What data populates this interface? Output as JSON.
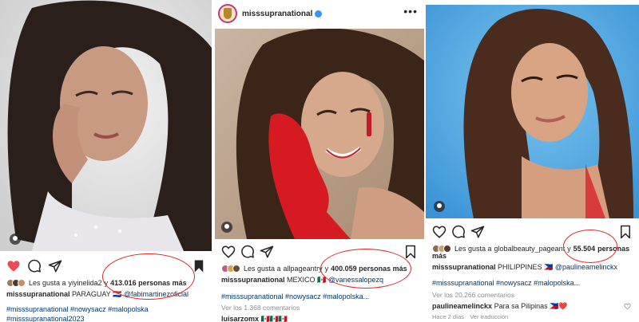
{
  "posts": [
    {
      "likes_prefix": "Les gusta a",
      "liker": "yiyinelida2",
      "likes_joiner": "y",
      "likes_count": "413.016 personas más",
      "caption_user": "misssupranational",
      "caption_text": "PARAGUAY",
      "caption_flag": "🇵🇾",
      "caption_mention": "@fabimartinezoficial",
      "hashtags": "#misssupranational #nowysacz #malopolska",
      "hashtags2": "#misssupranational2023",
      "liked": true,
      "accent": "#ed4956"
    },
    {
      "account": "misssupranational",
      "more_label": "•••",
      "likes_prefix": "Les gusta a",
      "liker": "allpageantry",
      "likes_joiner": "y",
      "likes_count": "400.059 personas más",
      "caption_user": "misssupranational",
      "caption_text": "MEXICO",
      "caption_flag": "🇲🇽",
      "caption_mention": "@vanessalopezq",
      "hashtags": "#misssupranational #nowysacz #malopolska...",
      "comments_link": "Ver los 1.368 comentarios",
      "next_comment": "luisarzomx 🇲🇽🇲🇽🇲🇽"
    },
    {
      "likes_prefix": "Les gusta a",
      "liker": "globalbeauty_pageant",
      "likes_joiner": "y",
      "likes_count": "55.504",
      "likes_suffix": "personas",
      "likes_suffix2": "más",
      "caption_user": "misssupranational",
      "caption_text": "PHILIPPINES",
      "caption_flag": "🇵🇭",
      "caption_mention": "@paulineamelinckx",
      "hashtags": "#misssupranational #nowysacz #malopolska...",
      "comments_link": "Ver los 20.266 comentarios",
      "comment_user": "paulineamelinckx",
      "comment_text": "Para sa Pilipinas 🇵🇭❤️",
      "comment_time": "Hace 2 días",
      "translate_label": "Ver traducción"
    }
  ],
  "colors": {
    "annotation_circle": "#e0262b",
    "link": "#00376b",
    "muted": "#8e8e8e",
    "like_red": "#ed4956"
  },
  "icons": [
    "heart-icon",
    "comment-icon",
    "share-icon",
    "bookmark-icon",
    "person-tag-icon",
    "verified-badge-icon",
    "more-icon"
  ]
}
